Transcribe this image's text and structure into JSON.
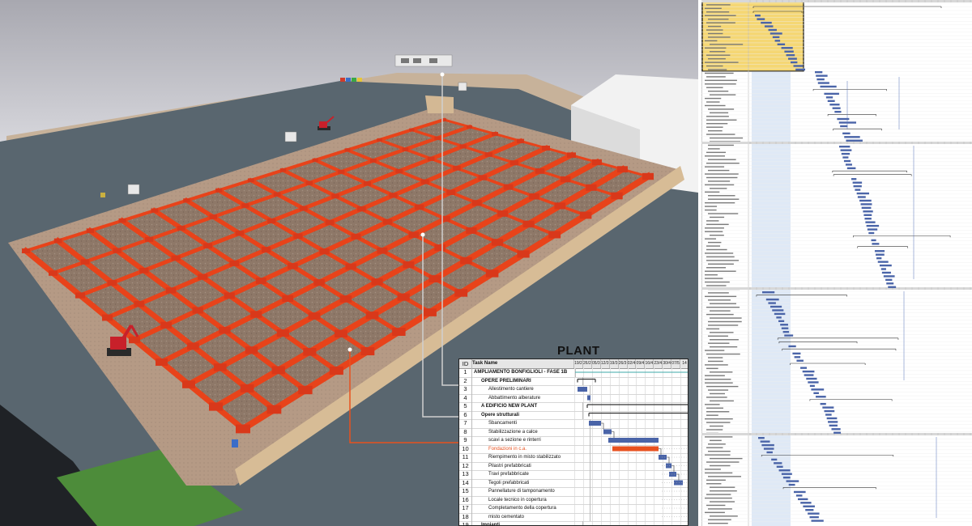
{
  "plant_title": "PLANT",
  "table": {
    "id_header": "ID",
    "name_header": "Task Name",
    "dates": [
      "19/2",
      "26/2",
      "05/3",
      "12/3",
      "19/3",
      "26/3",
      "02/4",
      "09/4",
      "16/4",
      "23/4",
      "30/4",
      "07/5",
      "14"
    ],
    "rows": [
      {
        "id": "1",
        "name": "AMPLIAMENTO BONFIGLIOLI - FASE 1B",
        "level": 0,
        "bold": true,
        "highlight": false
      },
      {
        "id": "2",
        "name": "OPERE PRELIMINARI",
        "level": 1,
        "bold": true,
        "highlight": false
      },
      {
        "id": "3",
        "name": "Allestimento cantiere",
        "level": 2,
        "bold": false,
        "highlight": false
      },
      {
        "id": "4",
        "name": "Abbattimento alberature",
        "level": 2,
        "bold": false,
        "highlight": false
      },
      {
        "id": "5",
        "name": "A EDIFICIO NEW PLANT",
        "level": 1,
        "bold": true,
        "highlight": false
      },
      {
        "id": "6",
        "name": "Opere strutturali",
        "level": 1,
        "bold": true,
        "highlight": false
      },
      {
        "id": "7",
        "name": "Sbancamenti",
        "level": 2,
        "bold": false,
        "highlight": false
      },
      {
        "id": "8",
        "name": "Stabilizzazione a calce",
        "level": 2,
        "bold": false,
        "highlight": false
      },
      {
        "id": "9",
        "name": "scavi a sezione e rinterri",
        "level": 2,
        "bold": false,
        "highlight": false
      },
      {
        "id": "10",
        "name": "Fondazioni in c.a.",
        "level": 2,
        "bold": false,
        "highlight": true
      },
      {
        "id": "11",
        "name": "Riempimento in misto stabilizzato",
        "level": 2,
        "bold": false,
        "highlight": false
      },
      {
        "id": "12",
        "name": "Pilastri prefabbricati",
        "level": 2,
        "bold": false,
        "highlight": false
      },
      {
        "id": "13",
        "name": "Travi prefabbricate",
        "level": 2,
        "bold": false,
        "highlight": false
      },
      {
        "id": "14",
        "name": "Tegoli prefabbricati",
        "level": 2,
        "bold": false,
        "highlight": false
      },
      {
        "id": "15",
        "name": "Pannellature di tamponamento",
        "level": 2,
        "bold": false,
        "highlight": false
      },
      {
        "id": "16",
        "name": "Locale tecnico in copertura",
        "level": 2,
        "bold": false,
        "highlight": false
      },
      {
        "id": "17",
        "name": "Completamento della copertura",
        "level": 2,
        "bold": false,
        "highlight": false
      },
      {
        "id": "18",
        "name": "misto cementato",
        "level": 2,
        "bold": false,
        "highlight": false
      },
      {
        "id": "19",
        "name": "Impianti",
        "level": 1,
        "bold": true,
        "highlight": false
      }
    ]
  },
  "colors": {
    "foundation": "#e8431a",
    "highlight": "#e8511f",
    "bar": "#4a64a8",
    "summary": "#333333",
    "ground": "#8f7a6a",
    "wall": "#c9ac8a",
    "asphalt": "#596770",
    "yellow": "#f5d774"
  },
  "icons": [
    "excavator-icon",
    "excavator-icon",
    "scaffold-icon",
    "dumpster-icon"
  ]
}
